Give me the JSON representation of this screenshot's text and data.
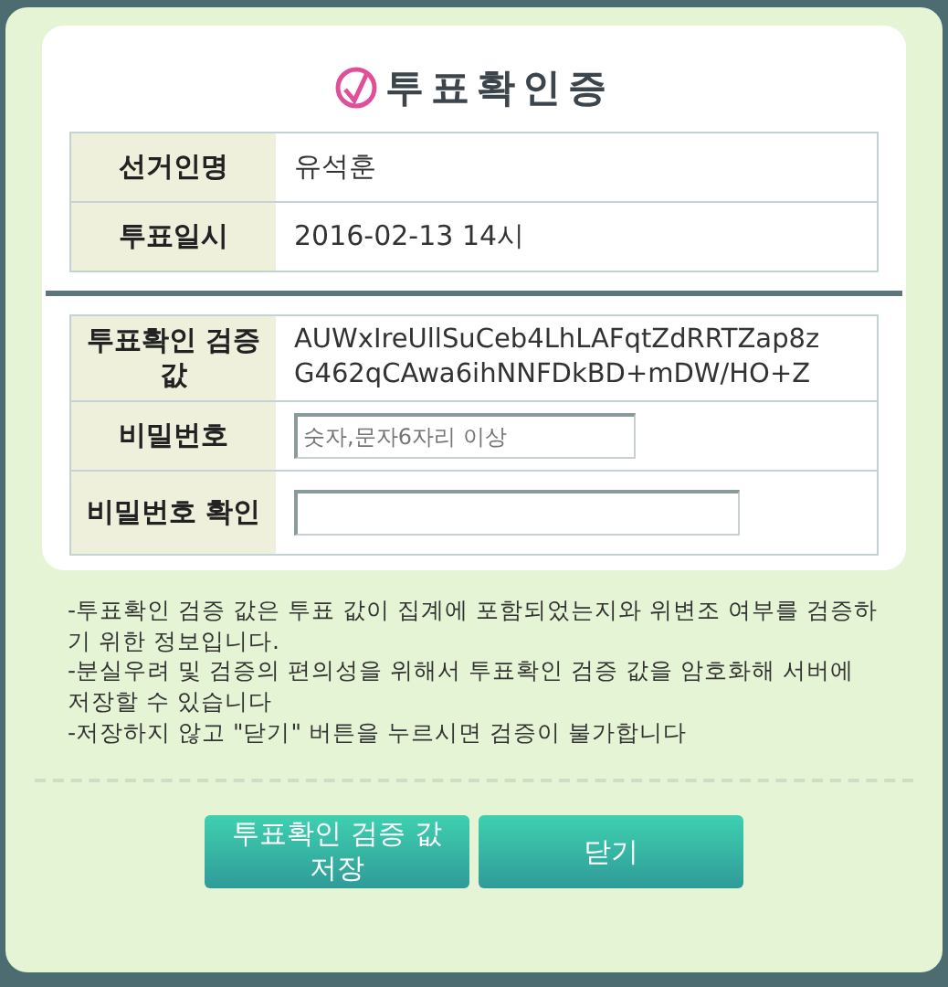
{
  "title": "투표확인증",
  "voter_table": [
    {
      "label": "선거인명",
      "value": "유석훈"
    },
    {
      "label": "투표일시",
      "value": "2016-02-13 14시"
    }
  ],
  "verify_table": [
    {
      "kind": "text",
      "label": "투표확인 검증 값",
      "value": "AUWxIreUllSuCeb4LhLAFqtZdRRTZap8zG462qCAwa6ihNNFDkBD+mDW/HO+Z"
    },
    {
      "kind": "input",
      "label": "비밀번호",
      "placeholder": "숫자,문자6자리 이상"
    },
    {
      "kind": "input",
      "label": "비밀번호 확인"
    }
  ],
  "notes": [
    "-투표확인 검증 값은 투표 값이 집계에 포함되었는지와 위변조 여부를 검증하기 위한 정보입니다.",
    "-분실우려 및 검증의 편의성을 위해서 투표확인 검증 값을 암호화해 서버에 저장할 수 있습니다",
    "-저장하지 않고 \"닫기\" 버튼을 누르시면 검증이 불가합니다"
  ],
  "buttons": [
    "투표확인 검증 값 저장",
    "닫기"
  ]
}
